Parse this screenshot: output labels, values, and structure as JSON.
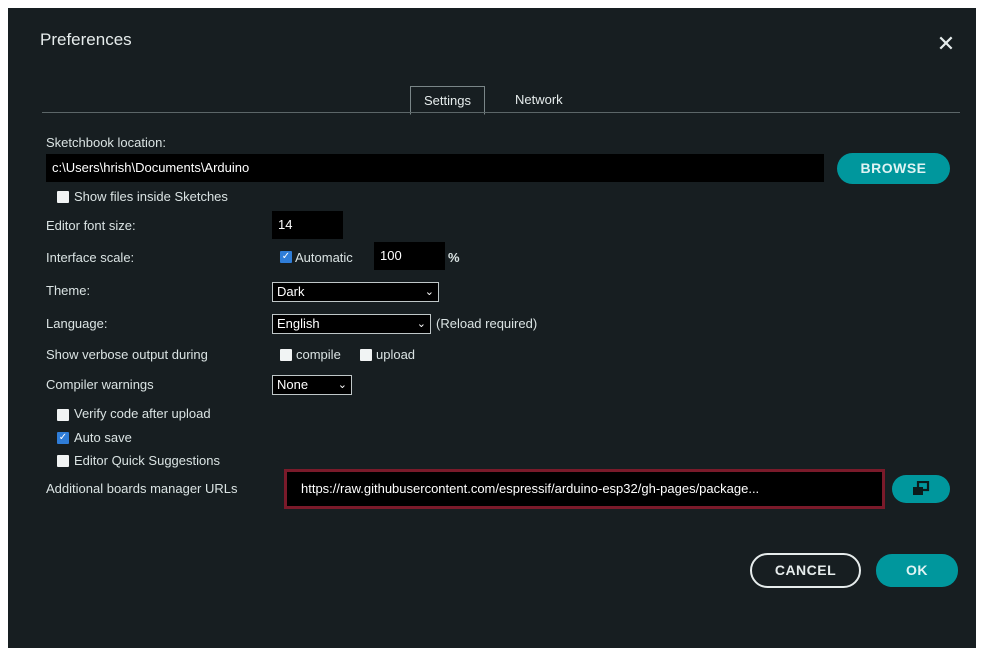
{
  "dialog": {
    "title": "Preferences",
    "close_glyph": "✕"
  },
  "tabs": [
    {
      "label": "Settings"
    },
    {
      "label": "Network"
    }
  ],
  "sketchbook": {
    "label": "Sketchbook location:",
    "value": "c:\\Users\\hrish\\Documents\\Arduino",
    "browse_label": "BROWSE",
    "show_files_label": "Show files inside Sketches"
  },
  "font_size": {
    "label": "Editor font size:",
    "value": "14"
  },
  "interface_scale": {
    "label": "Interface scale:",
    "automatic_label": "Automatic",
    "value": "100",
    "unit": "%"
  },
  "theme": {
    "label": "Theme:",
    "value": "Dark"
  },
  "language": {
    "label": "Language:",
    "value": "English",
    "note": "(Reload required)"
  },
  "verbose": {
    "label": "Show verbose output during",
    "compile_label": "compile",
    "upload_label": "upload"
  },
  "compiler_warnings": {
    "label": "Compiler warnings",
    "value": "None"
  },
  "options": {
    "verify_label": "Verify code after upload",
    "autosave_label": "Auto save",
    "quick_suggestions_label": "Editor Quick Suggestions"
  },
  "boards_urls": {
    "label": "Additional boards manager URLs",
    "value": "https://raw.githubusercontent.com/espressif/arduino-esp32/gh-pages/package..."
  },
  "buttons": {
    "cancel": "CANCEL",
    "ok": "OK"
  },
  "colors": {
    "background": "#171e21",
    "accent": "#00979d",
    "highlight": "#7a1a2a"
  }
}
